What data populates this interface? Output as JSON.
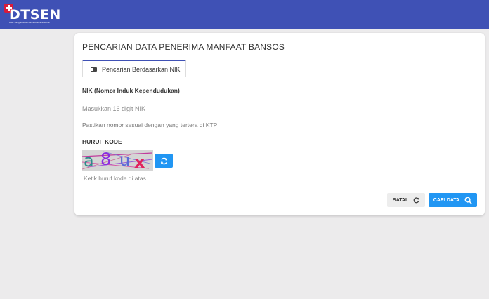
{
  "header": {
    "logo_text": "DTSEN",
    "logo_subtitle": "Data Tunggal Sosial dan Ekonomi Nasional",
    "background": "#3f51b5"
  },
  "card": {
    "title": "PENCARIAN DATA PENERIMA MANFAAT BANSOS",
    "tab": {
      "label": "Pencarian Berdasarkan NIK",
      "icon": "id-card-icon"
    }
  },
  "form": {
    "nik_label": "NIK (Nomor Induk Kependudukan)",
    "nik_placeholder": "Masukkan 16 digit NIK",
    "nik_value": "",
    "nik_hint": "Pastikan nomor sesuai dengan yang tertera di KTP",
    "code_label": "HURUF KODE",
    "captcha_chars": [
      "a",
      "8",
      "u",
      "x"
    ],
    "captcha_colors": [
      "#2e8b8b",
      "#8a2be2",
      "#5b6bd6",
      "#e0245e"
    ],
    "code_placeholder": "Ketik huruf kode di atas",
    "code_value": "",
    "refresh_icon": "refresh-icon"
  },
  "actions": {
    "cancel_label": "BATAL",
    "cancel_icon": "refresh-icon",
    "search_label": "CARI DATA",
    "search_icon": "search-icon",
    "accent": "#2196f3"
  }
}
